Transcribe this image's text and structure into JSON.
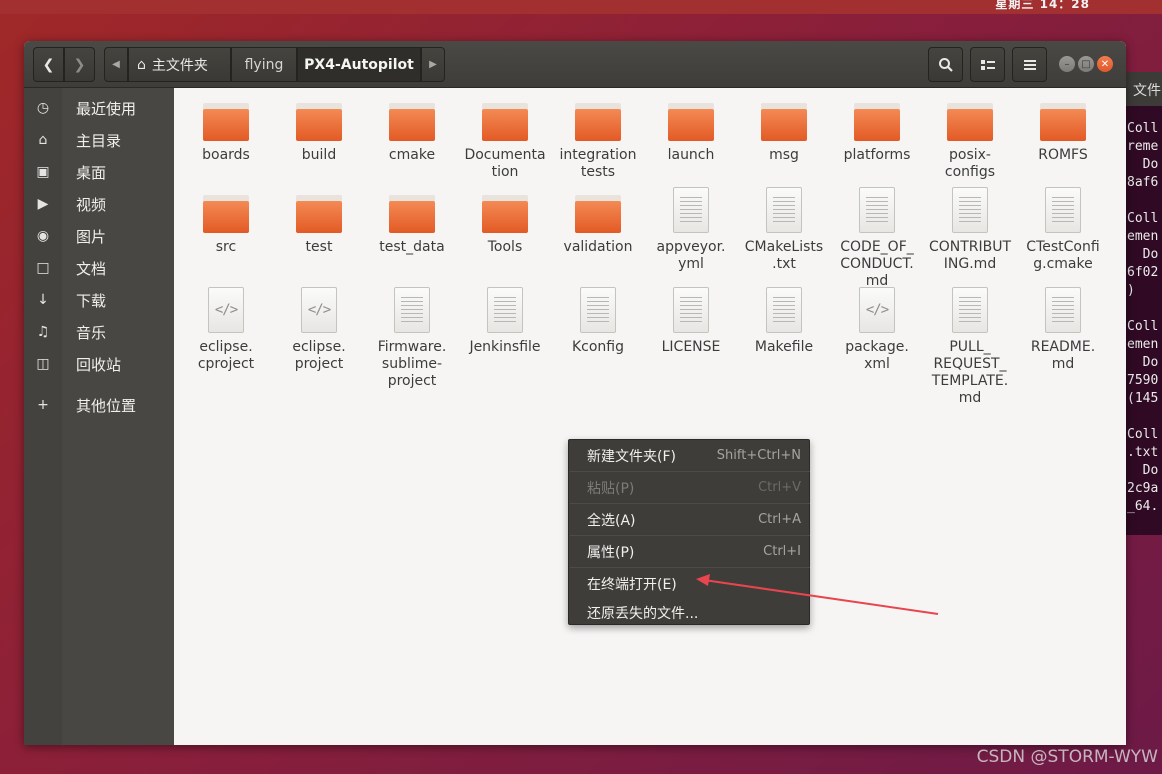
{
  "desktop": {
    "clock": "星期三 14：28",
    "watermark": "CSDN @STORM-WYW"
  },
  "terminal": {
    "title_fragment": "文件",
    "lines": [
      "Coll",
      "reme",
      "  Do",
      "8af6",
      "",
      "Coll",
      "emen",
      "  Do",
      "6f02",
      ")",
      "",
      "Coll",
      "emen",
      "  Do",
      "7590",
      "(145",
      "",
      "Coll",
      ".txt",
      "  Do",
      "2c9a",
      "_64."
    ]
  },
  "header": {
    "crumbs": {
      "home": "主文件夹",
      "flying": "flying",
      "current": "PX4-Autopilot"
    }
  },
  "sidebar": {
    "items": [
      {
        "icon": "clock-icon",
        "label": "最近使用"
      },
      {
        "icon": "home-icon",
        "label": "主目录"
      },
      {
        "icon": "folder-icon",
        "label": "桌面"
      },
      {
        "icon": "video-icon",
        "label": "视频"
      },
      {
        "icon": "camera-icon",
        "label": "图片"
      },
      {
        "icon": "document-icon",
        "label": "文档"
      },
      {
        "icon": "download-icon",
        "label": "下载"
      },
      {
        "icon": "music-icon",
        "label": "音乐"
      },
      {
        "icon": "trash-icon",
        "label": "回收站"
      },
      {
        "icon": "plus-icon",
        "label": "其他位置"
      }
    ]
  },
  "files": [
    {
      "name": "boards",
      "type": "folder"
    },
    {
      "name": "build",
      "type": "folder"
    },
    {
      "name": "cmake",
      "type": "folder"
    },
    {
      "name": "Documenta\ntion",
      "type": "folder"
    },
    {
      "name": "integration\ntests",
      "type": "folder"
    },
    {
      "name": "launch",
      "type": "folder"
    },
    {
      "name": "msg",
      "type": "folder"
    },
    {
      "name": "platforms",
      "type": "folder"
    },
    {
      "name": "posix-\nconfigs",
      "type": "folder"
    },
    {
      "name": "ROMFS",
      "type": "folder"
    },
    {
      "name": "src",
      "type": "folder"
    },
    {
      "name": "test",
      "type": "folder"
    },
    {
      "name": "test_data",
      "type": "folder"
    },
    {
      "name": "Tools",
      "type": "folder"
    },
    {
      "name": "validation",
      "type": "folder"
    },
    {
      "name": "appveyor.\nyml",
      "type": "text"
    },
    {
      "name": "CMakeLists\n.txt",
      "type": "text"
    },
    {
      "name": "CODE_OF_\nCONDUCT.\nmd",
      "type": "text"
    },
    {
      "name": "CONTRIBUT\nING.md",
      "type": "text"
    },
    {
      "name": "CTestConfi\ng.cmake",
      "type": "text"
    },
    {
      "name": "eclipse.\ncproject",
      "type": "code"
    },
    {
      "name": "eclipse.\nproject",
      "type": "code"
    },
    {
      "name": "Firmware.\nsublime-\nproject",
      "type": "text"
    },
    {
      "name": "Jenkinsfile",
      "type": "text"
    },
    {
      "name": "Kconfig",
      "type": "text"
    },
    {
      "name": "LICENSE",
      "type": "text"
    },
    {
      "name": "Makefile",
      "type": "text"
    },
    {
      "name": "package.\nxml",
      "type": "code"
    },
    {
      "name": "PULL_\nREQUEST_\nTEMPLATE.\nmd",
      "type": "text"
    },
    {
      "name": "README.\nmd",
      "type": "text"
    }
  ],
  "context_menu": {
    "items": [
      {
        "label": "新建文件夹(F)",
        "accel": "Shift+Ctrl+N",
        "enabled": true
      },
      {
        "label": "粘贴(P)",
        "accel": "Ctrl+V",
        "enabled": false
      },
      {
        "label": "全选(A)",
        "accel": "Ctrl+A",
        "enabled": true
      },
      {
        "label": "属性(P)",
        "accel": "Ctrl+I",
        "enabled": true
      },
      {
        "label": "在终端打开(E)",
        "accel": "",
        "enabled": true
      },
      {
        "label": "还原丢失的文件...",
        "accel": "",
        "enabled": true
      }
    ]
  },
  "colors": {
    "annotation_arrow": "#e8454f",
    "folder_orange": "#e9662f"
  }
}
